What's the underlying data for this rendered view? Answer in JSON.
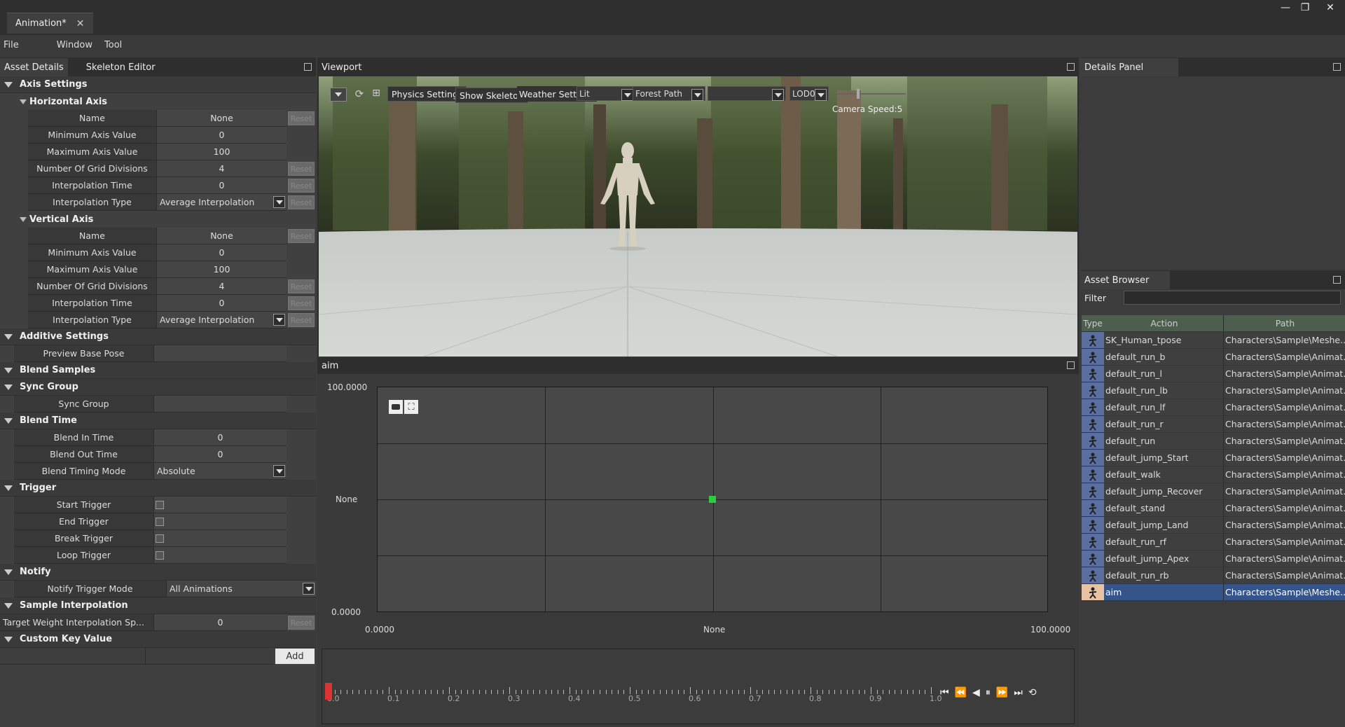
{
  "window": {
    "tab_title": "Animation*",
    "close": "✕",
    "minimize": "—",
    "restore": "❐",
    "close_win": "✕"
  },
  "menu": [
    "File",
    "Window",
    "Tool"
  ],
  "left_panel": {
    "tabs": [
      "Asset Details",
      "Skeleton Editor"
    ],
    "sections": {
      "axis_settings": "Axis Settings",
      "horizontal_axis": "Horizontal Axis",
      "vertical_axis": "Vertical Axis",
      "additive_settings": "Additive Settings",
      "blend_samples": "Blend Samples",
      "sync_group": "Sync Group",
      "blend_time": "Blend Time",
      "trigger": "Trigger",
      "notify": "Notify",
      "sample_interpolation": "Sample Interpolation",
      "custom_key_value": "Custom Key Value"
    },
    "reset_label": "Reset",
    "horizontal": [
      {
        "label": "Name",
        "value": "None",
        "reset": true
      },
      {
        "label": "Minimum Axis Value",
        "value": "0",
        "reset": false
      },
      {
        "label": "Maximum Axis Value",
        "value": "100",
        "reset": false
      },
      {
        "label": "Number Of Grid Divisions",
        "value": "4",
        "reset": true
      },
      {
        "label": "Interpolation Time",
        "value": "0",
        "reset": true
      },
      {
        "label": "Interpolation Type",
        "value": "Average Interpolation",
        "reset": true,
        "dropdown": true
      }
    ],
    "vertical": [
      {
        "label": "Name",
        "value": "None",
        "reset": true
      },
      {
        "label": "Minimum Axis Value",
        "value": "0",
        "reset": false
      },
      {
        "label": "Maximum Axis Value",
        "value": "100",
        "reset": false
      },
      {
        "label": "Number Of Grid Divisions",
        "value": "4",
        "reset": true
      },
      {
        "label": "Interpolation Time",
        "value": "0",
        "reset": true
      },
      {
        "label": "Interpolation Type",
        "value": "Average Interpolation",
        "reset": true,
        "dropdown": true
      }
    ],
    "preview_base_pose": "Preview Base Pose",
    "sync_group_label": "Sync Group",
    "blend_in_time": {
      "label": "Blend In Time",
      "value": "0"
    },
    "blend_out_time": {
      "label": "Blend Out Time",
      "value": "0"
    },
    "blend_timing_mode": {
      "label": "Blend Timing Mode",
      "value": "Absolute"
    },
    "triggers": [
      "Start Trigger",
      "End Trigger",
      "Break Trigger",
      "Loop Trigger"
    ],
    "notify_trigger_mode": {
      "label": "Notify Trigger Mode",
      "value": "All Animations"
    },
    "target_weight": {
      "label": "Target Weight Interpolation Sp...",
      "value": "0"
    },
    "add_label": "Add"
  },
  "viewport": {
    "title": "Viewport",
    "physics_settings": "Physics Settings",
    "show_skeleton": "Show Skeleton",
    "weather_settings": "Weather Settings",
    "lit": "Lit",
    "scene": "Forest Path",
    "lod": "LOD0",
    "camera_speed": "Camera Speed:5"
  },
  "graph": {
    "title": "aim",
    "y_max": "100.0000",
    "y_mid": "None",
    "y_min": "0.0000",
    "x_min": "0.0000",
    "x_mid": "None",
    "x_max": "100.0000",
    "sample_point": {
      "x": 50,
      "y": 50
    }
  },
  "timeline": {
    "ticks": [
      "0.0",
      "0.1",
      "0.2",
      "0.3",
      "0.4",
      "0.5",
      "0.6",
      "0.7",
      "0.8",
      "0.9",
      "1.0"
    ],
    "current": 0.0
  },
  "details_panel": {
    "title": "Details Panel"
  },
  "asset_browser": {
    "title": "Asset Browser",
    "filter_label": "Filter",
    "columns": [
      "Type",
      "Action",
      "Path"
    ],
    "rows": [
      {
        "action": "SK_Human_tpose",
        "path": "Characters\\Sample\\Meshe..."
      },
      {
        "action": "default_run_b",
        "path": "Characters\\Sample\\Animat..."
      },
      {
        "action": "default_run_l",
        "path": "Characters\\Sample\\Animat..."
      },
      {
        "action": "default_run_lb",
        "path": "Characters\\Sample\\Animat..."
      },
      {
        "action": "default_run_lf",
        "path": "Characters\\Sample\\Animat..."
      },
      {
        "action": "default_run_r",
        "path": "Characters\\Sample\\Animat..."
      },
      {
        "action": "default_run",
        "path": "Characters\\Sample\\Animat..."
      },
      {
        "action": "default_jump_Start",
        "path": "Characters\\Sample\\Animat..."
      },
      {
        "action": "default_walk",
        "path": "Characters\\Sample\\Animat..."
      },
      {
        "action": "default_jump_Recover",
        "path": "Characters\\Sample\\Animat..."
      },
      {
        "action": "default_stand",
        "path": "Characters\\Sample\\Animat..."
      },
      {
        "action": "default_jump_Land",
        "path": "Characters\\Sample\\Animat..."
      },
      {
        "action": "default_run_rf",
        "path": "Characters\\Sample\\Animat..."
      },
      {
        "action": "default_jump_Apex",
        "path": "Characters\\Sample\\Animat..."
      },
      {
        "action": "default_run_rb",
        "path": "Characters\\Sample\\Animat..."
      },
      {
        "action": "aim",
        "path": "Characters\\Sample\\Meshe...",
        "selected": true
      }
    ]
  }
}
